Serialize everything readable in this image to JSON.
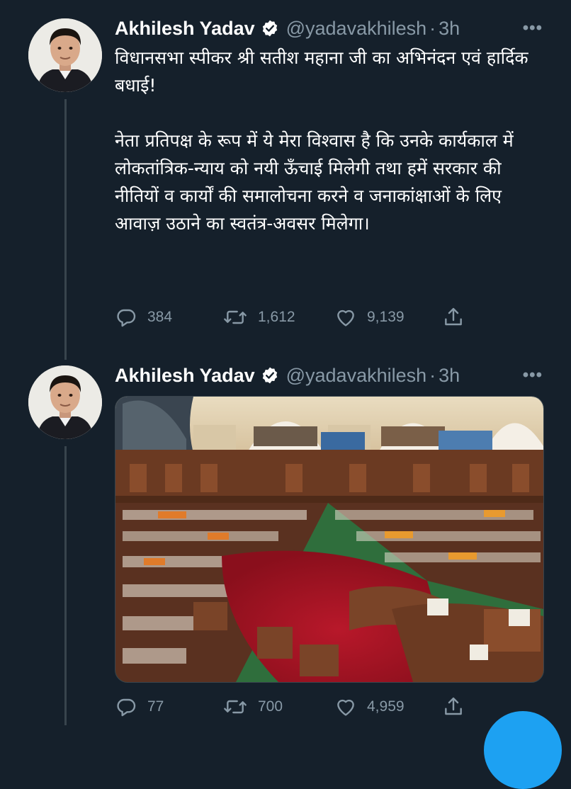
{
  "tweets": [
    {
      "author": {
        "name": "Akhilesh Yadav",
        "handle": "@yadavakhilesh",
        "verified_icon": "verified-badge-icon"
      },
      "time": "3h",
      "more_label": "•••",
      "text_paragraphs": [
        "विधानसभा स्पीकर श्री सतीश महाना जी का अभिनंदन एवं हार्दिक बधाई!",
        "नेता प्रतिपक्ष के रूप में ये मेरा विश्वास है कि उनके कार्यकाल में लोकतांत्रिक-न्याय को नयी ऊँचाई मिलेगी तथा हमें सरकार की नीतियों व कार्यों की समालोचना करने व जनाकांक्षाओं के लिए आवाज़ उठाने का स्वतंत्र-अवसर मिलेगा।"
      ],
      "stats": {
        "replies": "384",
        "retweets": "1,612",
        "likes": "9,139"
      }
    },
    {
      "author": {
        "name": "Akhilesh Yadav",
        "handle": "@yadavakhilesh",
        "verified_icon": "verified-badge-icon"
      },
      "time": "3h",
      "more_label": "•••",
      "media": {
        "type": "photo",
        "subject": "assembly-hall"
      },
      "stats": {
        "replies": "77",
        "retweets": "700",
        "likes": "4,959"
      }
    }
  ],
  "colors": {
    "background": "#15202b",
    "secondary_text": "#8899a6",
    "divider": "#38444d",
    "accent": "#1da1f2"
  }
}
